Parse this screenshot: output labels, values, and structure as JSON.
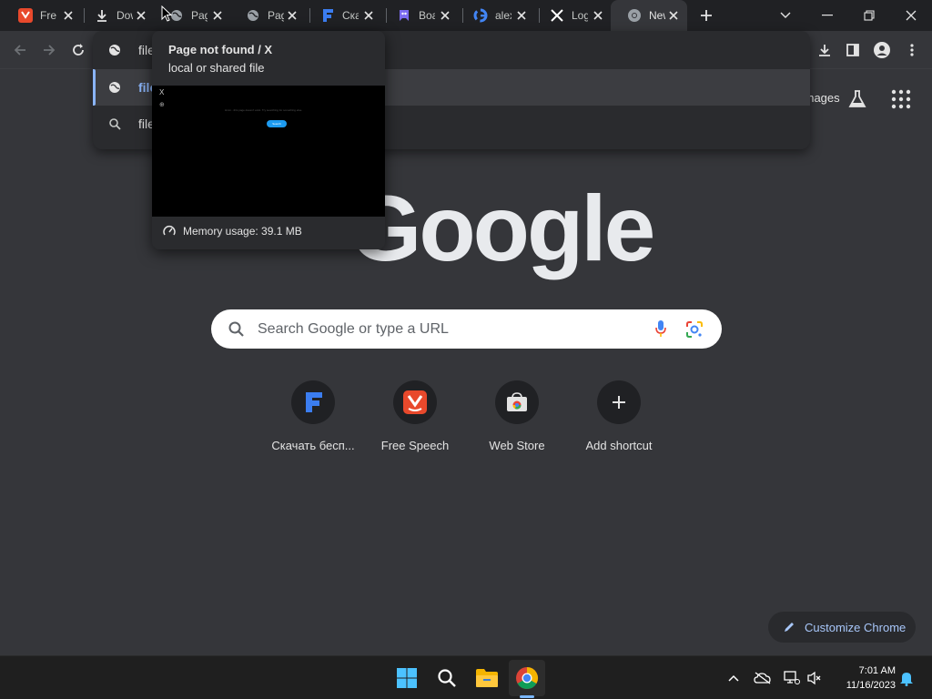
{
  "tabs": [
    {
      "title": "Free Speech",
      "favicon": "vk-logo-icon"
    },
    {
      "title": "Downloads",
      "favicon": "download-icon"
    },
    {
      "title": "Page not found",
      "favicon": "globe-icon"
    },
    {
      "title": "Page not found",
      "favicon": "globe-icon"
    },
    {
      "title": "Скачать",
      "favicon": "f-logo-icon"
    },
    {
      "title": "Board",
      "favicon": "twitch-logo-icon"
    },
    {
      "title": "alex",
      "favicon": "google-g-icon"
    },
    {
      "title": "Log in",
      "favicon": "x-logo-icon"
    },
    {
      "title": "New Tab",
      "favicon": "chrome-icon"
    }
  ],
  "omnibox": {
    "rows": [
      {
        "text": "file",
        "icon": "globe-icon"
      },
      {
        "text": "file",
        "icon": "globe-icon"
      },
      {
        "text": "file",
        "icon": "search-icon"
      }
    ]
  },
  "hovercard": {
    "title": "Page not found / X",
    "subtitle": "local or shared file",
    "memory": "Memory usage: 39.1 MB",
    "preview_x": "X",
    "preview_text": "Hmm...this page doesn't exist. Try searching for something else.",
    "preview_button": "Search"
  },
  "ntp": {
    "images_link": "Images",
    "search_placeholder": "Search Google or type a URL",
    "logo_text": "Google",
    "shortcuts": [
      {
        "label": "Скачать бесп...",
        "icon": "f-logo-icon"
      },
      {
        "label": "Free Speech",
        "icon": "vk-logo-icon"
      },
      {
        "label": "Web Store",
        "icon": "web-store-icon"
      },
      {
        "label": "Add shortcut",
        "icon": "plus-icon"
      }
    ],
    "customize_label": "Customize Chrome"
  },
  "taskbar": {
    "time": "7:01 AM",
    "date": "11/16/2023"
  },
  "colors": {
    "accent": "#8ab4f8",
    "background": "#35363a",
    "tabstrip": "#202124"
  }
}
